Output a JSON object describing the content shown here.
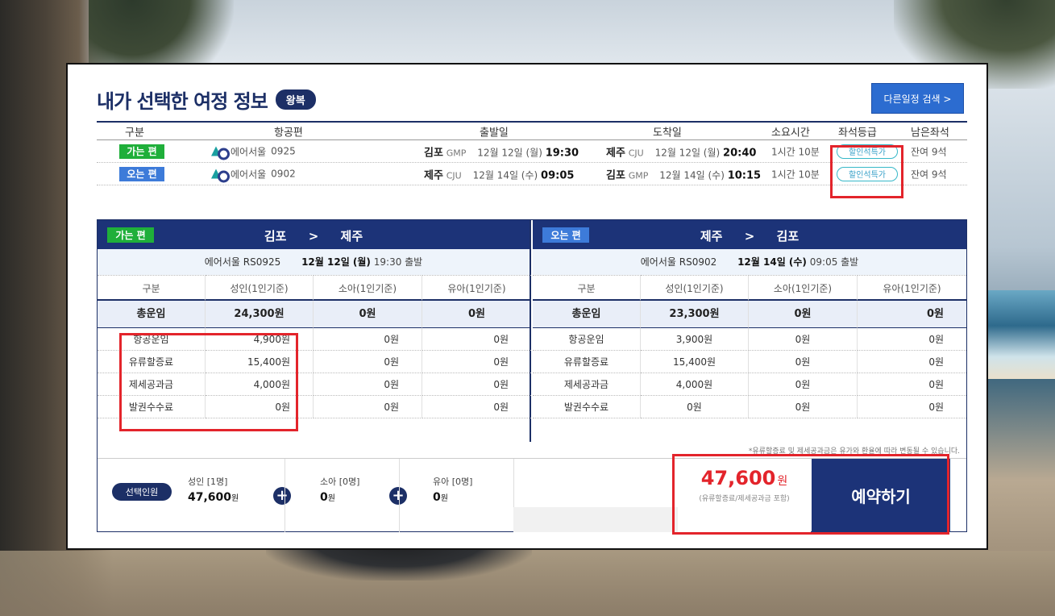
{
  "title": "내가 선택한 여정 정보",
  "trip_type": "왕복",
  "other_search": "다른일정 검색 >",
  "summary": {
    "headers": [
      "구분",
      "항공편",
      "출발일",
      "도착일",
      "소요시간",
      "좌석등급",
      "남은좌석"
    ],
    "rows": [
      {
        "dir": "가는 편",
        "airline": "에어서울",
        "flight_no": "0925",
        "dep_city": "김포",
        "dep_code": "GMP",
        "dep_date": "12월 12일 (월)",
        "dep_time": "19:30",
        "arr_city": "제주",
        "arr_code": "CJU",
        "arr_date": "12월 12일 (월)",
        "arr_time": "20:40",
        "duration": "1시간 10분",
        "seat_class": "할인석특가",
        "seats_left": "잔여 9석"
      },
      {
        "dir": "오는 편",
        "airline": "에어서울",
        "flight_no": "0902",
        "dep_city": "제주",
        "dep_code": "CJU",
        "dep_date": "12월 14일 (수)",
        "dep_time": "09:05",
        "arr_city": "김포",
        "arr_code": "GMP",
        "arr_date": "12월 14일 (수)",
        "arr_time": "10:15",
        "duration": "1시간 10분",
        "seat_class": "할인석특가",
        "seats_left": "잔여 9석"
      }
    ]
  },
  "fare": {
    "outbound": {
      "dir": "가는 편",
      "from": "김포",
      "arrow": ">",
      "to": "제주",
      "airline": "에어서울",
      "flight": "RS0925",
      "date": "12월 12일 (월)",
      "dep": "19:30 출발",
      "col_headers": [
        "구분",
        "성인(1인기준)",
        "소아(1인기준)",
        "유아(1인기준)"
      ],
      "total": [
        "총운임",
        "24,300원",
        "0원",
        "0원"
      ],
      "items": [
        [
          "항공운임",
          "4,900원",
          "0원",
          "0원"
        ],
        [
          "유류할증료",
          "15,400원",
          "0원",
          "0원"
        ],
        [
          "제세공과금",
          "4,000원",
          "0원",
          "0원"
        ],
        [
          "발권수수료",
          "0원",
          "0원",
          "0원"
        ]
      ]
    },
    "inbound": {
      "dir": "오는 편",
      "from": "제주",
      "arrow": ">",
      "to": "김포",
      "airline": "에어서울",
      "flight": "RS0902",
      "date": "12월 14일 (수)",
      "dep": "09:05 출발",
      "col_headers": [
        "구분",
        "성인(1인기준)",
        "소아(1인기준)",
        "유아(1인기준)"
      ],
      "total": [
        "총운임",
        "23,300원",
        "0원",
        "0원"
      ],
      "items": [
        [
          "항공운임",
          "3,900원",
          "0원",
          "0원"
        ],
        [
          "유류할증료",
          "15,400원",
          "0원",
          "0원"
        ],
        [
          "제세공과금",
          "4,000원",
          "0원",
          "0원"
        ],
        [
          "발권수수료",
          "0원",
          "0원",
          "0원"
        ]
      ]
    },
    "note": "*유류할증료 및 제세공과금은 유가와 환율에 따라 변동될 수 있습니다."
  },
  "bottom": {
    "people_label": "선택인원",
    "adult": {
      "title": "성인 [1명]",
      "amount": "47,600",
      "unit": "원"
    },
    "child": {
      "title": "소아 [0명]",
      "amount": "0",
      "unit": "원"
    },
    "infant": {
      "title": "유아 [0명]",
      "amount": "0",
      "unit": "원"
    },
    "plus": "+",
    "total_amount": "47,600",
    "total_unit": "원",
    "total_note": "(유류할증료/제세공과금 포함)",
    "reserve": "예약하기"
  },
  "colors": {
    "navy": "#1c3378",
    "go_green": "#1faf3a",
    "back_blue": "#3d7bd9",
    "highlight_red": "#e3242b"
  }
}
